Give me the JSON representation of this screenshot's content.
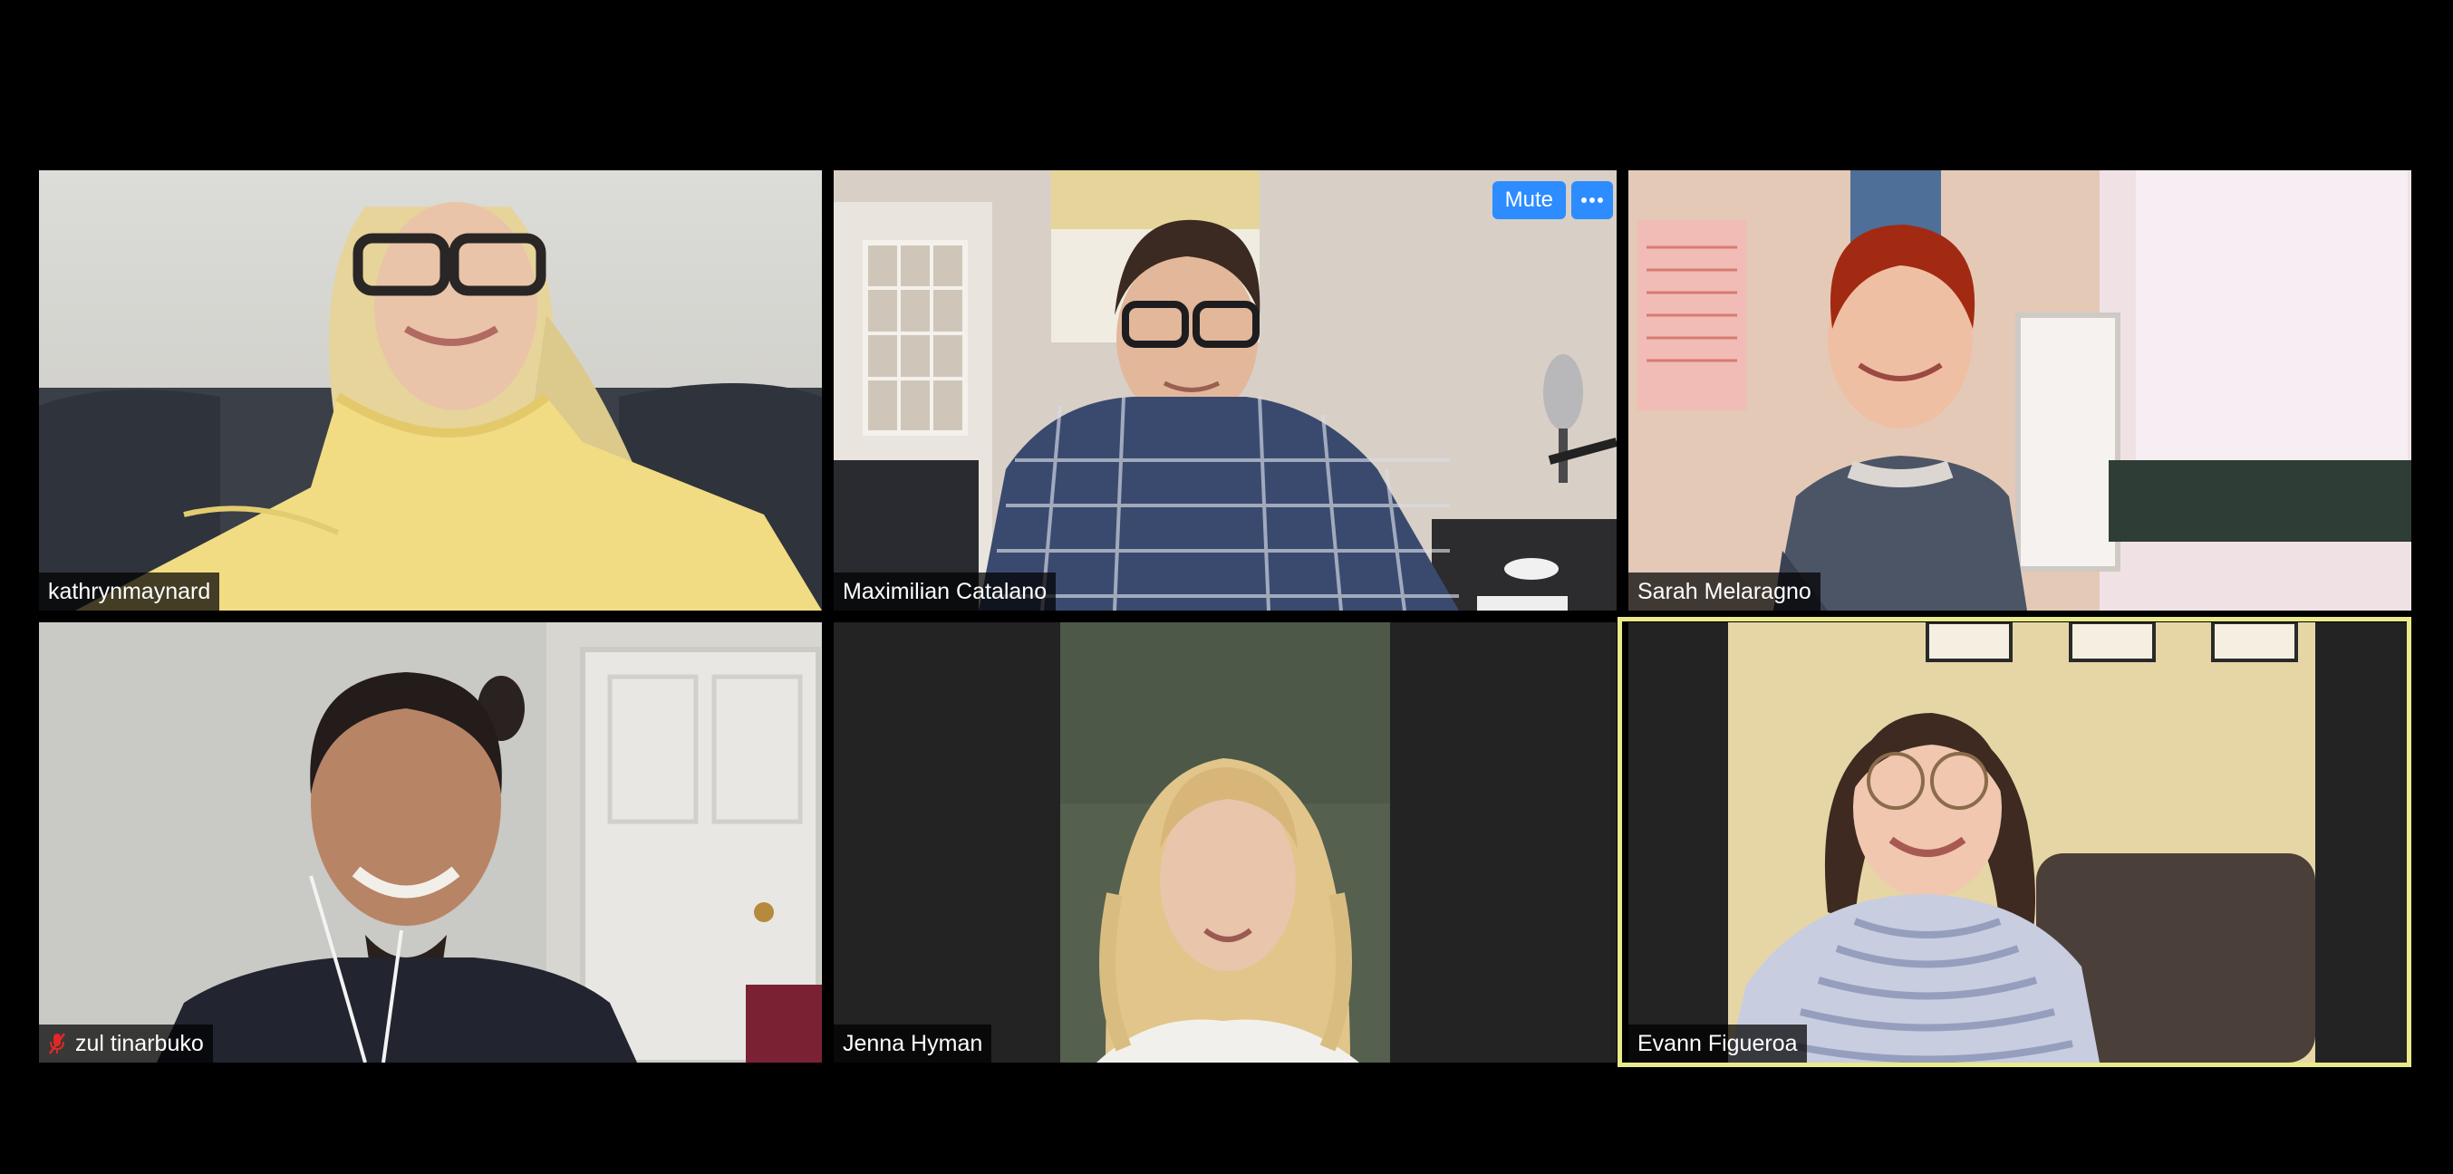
{
  "participants": [
    {
      "name": "kathrynmaynard",
      "muted": false,
      "active_speaker": false
    },
    {
      "name": "Maximilian Catalano",
      "muted": false,
      "active_speaker": false
    },
    {
      "name": "Sarah Melaragno",
      "muted": false,
      "active_speaker": false
    },
    {
      "name": "zul tinarbuko",
      "muted": true,
      "active_speaker": false
    },
    {
      "name": "Jenna Hyman",
      "muted": false,
      "active_speaker": false
    },
    {
      "name": "Evann Figueroa",
      "muted": false,
      "active_speaker": true
    }
  ],
  "hover_controls": {
    "mute_label": "Mute",
    "more_icon": "more-horizontal-icon"
  },
  "colors": {
    "background": "#000000",
    "tile_background": "#232323",
    "active_speaker_border": "#e9ea8a",
    "button_blue": "#2d8cff",
    "muted_mic_red": "#e02828"
  }
}
